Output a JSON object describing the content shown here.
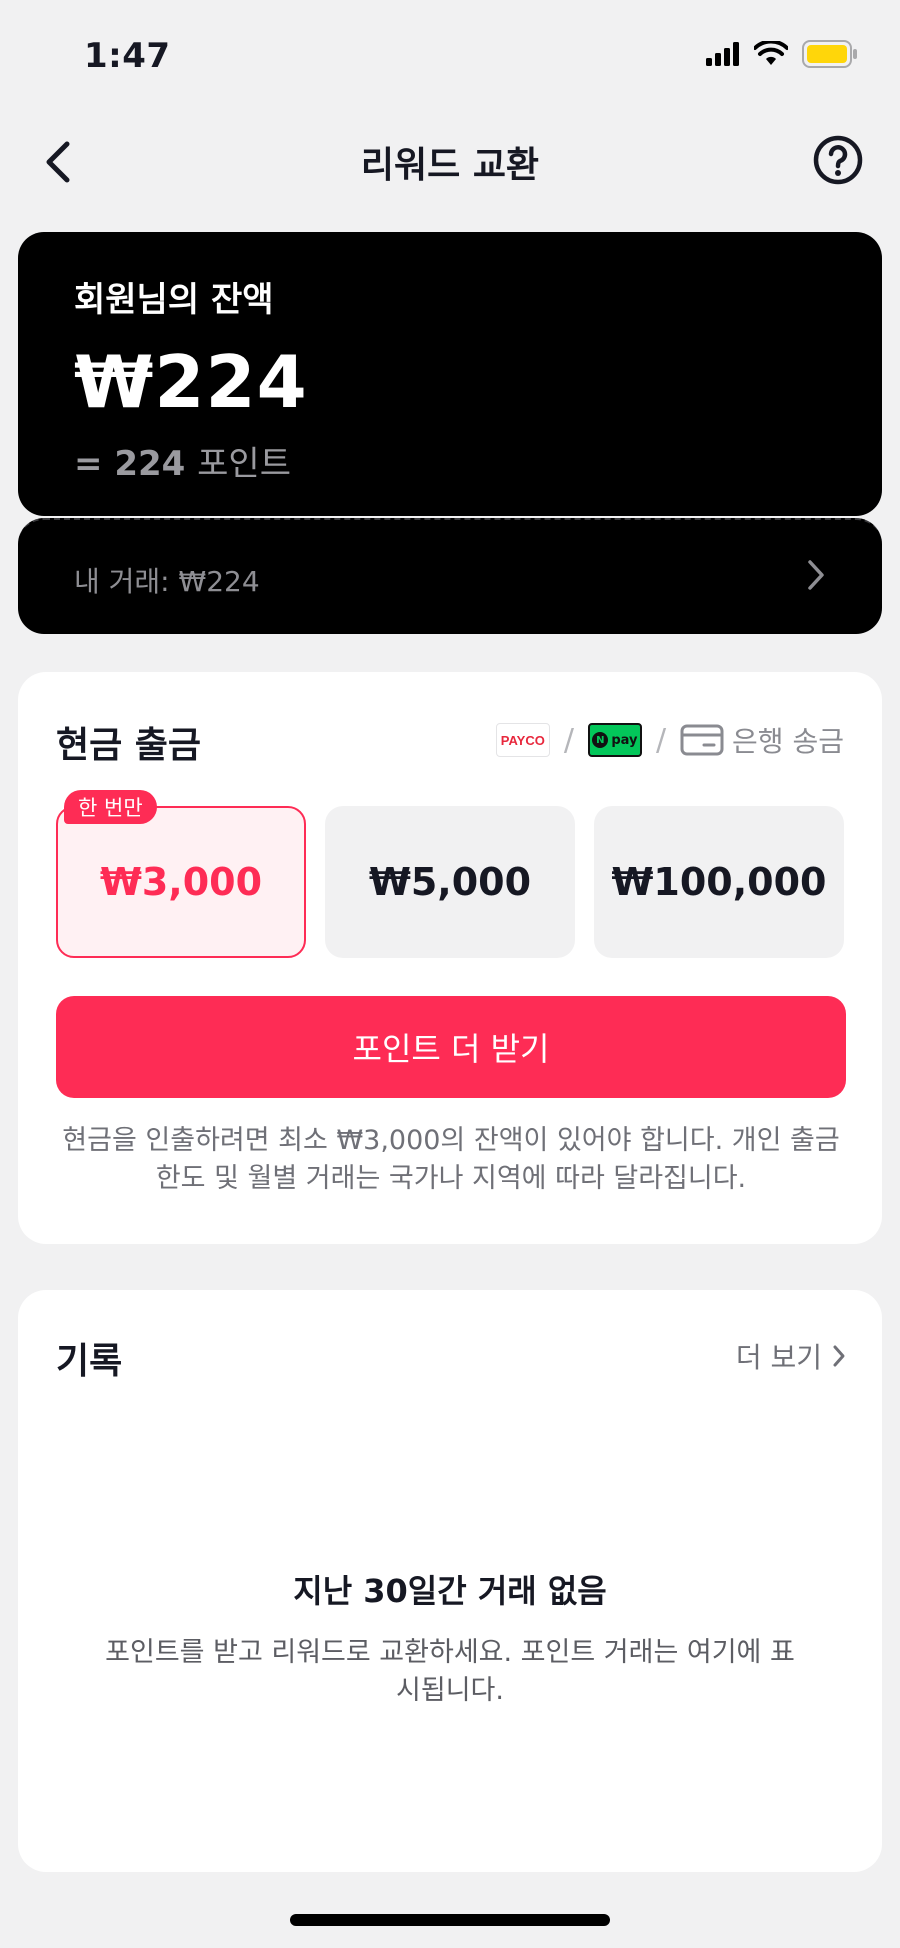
{
  "status_bar": {
    "time": "1:47",
    "icons": [
      "signal-icon",
      "wifi-icon",
      "battery-icon"
    ],
    "battery_color": "#ffd60a"
  },
  "header": {
    "title": "리워드 교환",
    "back_icon": "chevron-left-icon",
    "help_icon": "question-circle-icon"
  },
  "balance": {
    "label": "회원님의 잔액",
    "amount": "₩224",
    "points_prefix": "= 224",
    "points_unit": "포인트"
  },
  "transactions": {
    "label": "내 거래: ₩224"
  },
  "cash_out": {
    "title": "현금 출금",
    "methods": {
      "payco": "PAYCO",
      "npay": "pay",
      "npay_badge": "N",
      "separator": "/",
      "bank": "은행 송금"
    },
    "once_badge": "한 번만",
    "options": [
      "₩3,000",
      "₩5,000",
      "₩100,000"
    ],
    "selected_index": 0,
    "more_points_button": "포인트 더 받기",
    "note": "현금을 인출하려면 최소 ₩3,000의 잔액이 있어야 합니다. 개인 출금 한도 및 월별 거래는 국가나 지역에 따라 달라집니다."
  },
  "history": {
    "title": "기록",
    "more_label": "더 보기",
    "empty_title": "지난 30일간 거래 없음",
    "empty_desc": "포인트를 받고 리워드로 교환하세요. 포인트 거래는 여기에 표시됩니다."
  },
  "colors": {
    "accent": "#fe2c55",
    "card_dark": "#000000",
    "background": "#f1f1f2"
  }
}
